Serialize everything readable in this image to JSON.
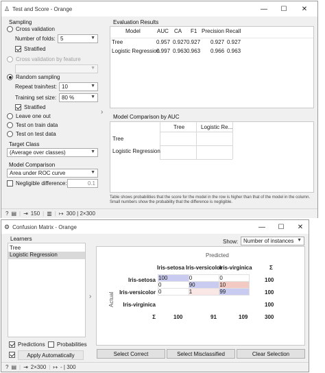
{
  "ts": {
    "title": "Test and Score - Orange",
    "sampling_title": "Sampling",
    "cv_label": "Cross validation",
    "folds_label": "Number of folds:",
    "folds_value": "5",
    "stratified_label": "Stratified",
    "cv_feature_label": "Cross validation by feature",
    "random_label": "Random sampling",
    "repeat_label": "Repeat train/test:",
    "repeat_value": "10",
    "trainsize_label": "Training set size:",
    "trainsize_value": "80 %",
    "stratified2_label": "Stratified",
    "loo_label": "Leave one out",
    "train_label": "Test on train data",
    "test_label": "Test on test data",
    "target_title": "Target Class",
    "target_value": "(Average over classes)",
    "mc_title": "Model Comparison",
    "mc_value": "Area under ROC curve",
    "negligible_label": "Negligible difference:",
    "negligible_value": "0.1",
    "eval_title": "Evaluation Results",
    "eval_headers": [
      "Model",
      "AUC",
      "CA",
      "F1",
      "Precision",
      "Recall"
    ],
    "eval_rows": [
      [
        "Tree",
        "0.957",
        "0.927",
        "0.927",
        "0.927",
        "0.927"
      ],
      [
        "Logistic Regression",
        "0.997",
        "0.963",
        "0.963",
        "0.966",
        "0.963"
      ]
    ],
    "cmp_title": "Model Comparison by AUC",
    "cmp_cols": [
      "Tree",
      "Logistic Re..."
    ],
    "cmp_rows": [
      "Tree",
      "Logistic Regression"
    ],
    "footnote": "Table shows probabilities that the score for the model in the row is higher than that of the model in the column. Small numbers show the probability that the difference is negligible.",
    "status_in": "150",
    "status_mid": "|",
    "status_out": "300 | 2×300"
  },
  "cm": {
    "title": "Confusion Matrix - Orange",
    "learners_title": "Learners",
    "learners": [
      "Tree",
      "Logistic Regression"
    ],
    "show_label": "Show:",
    "show_value": "Number of instances",
    "predicted_label": "Predicted",
    "actual_label": "Actual",
    "classes": [
      "Iris-setosa",
      "Iris-versicolor",
      "Iris-virginica"
    ],
    "sigma": "Σ",
    "matrix": [
      [
        "100",
        "0",
        "0"
      ],
      [
        "0",
        "90",
        "10"
      ],
      [
        "0",
        "1",
        "99"
      ]
    ],
    "row_sums": [
      "100",
      "100",
      "100"
    ],
    "col_sums": [
      "100",
      "91",
      "109"
    ],
    "total": "300",
    "predictions_label": "Predictions",
    "probabilities_label": "Probabilities",
    "apply_label": "Apply Automatically",
    "select_correct": "Select Correct",
    "select_misclassified": "Select Misclassified",
    "clear_selection": "Clear Selection",
    "status_in": "2×300",
    "status_out": "- | 300"
  },
  "colors": {
    "diag": "#c9ccf0",
    "off": "#f3c9c3",
    "offlight": "#f9e7e5"
  }
}
